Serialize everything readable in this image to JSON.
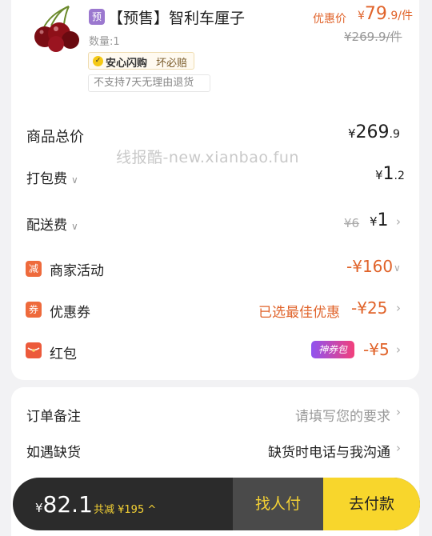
{
  "product": {
    "tag": "预",
    "title": "【预售】智利车厘子",
    "quantity": "数量:1",
    "price_label": "优惠价",
    "price_currency": "¥",
    "price_int": "79",
    "price_dec": ".9/件",
    "original_price": "¥269.9/件",
    "badge_check": "✓",
    "badge_assured": "安心闪购",
    "badge_broken": "坏必赔",
    "no_return": "不支持7天无理由退货"
  },
  "watermark": "线报酷-new.xianbao.fun",
  "summary": {
    "total": {
      "label": "商品总价",
      "currency": "¥",
      "int": "269",
      "dec": ".9"
    },
    "packing": {
      "label": "打包费",
      "currency": "¥",
      "int": "1",
      "dec": ".2"
    },
    "delivery": {
      "label": "配送费",
      "old": "¥6",
      "currency": "¥",
      "int": "1"
    },
    "merchant": {
      "icon": "减",
      "label": "商家活动",
      "value": "-¥160"
    },
    "coupon": {
      "icon": "券",
      "label": "优惠券",
      "note": "已选最佳优惠",
      "value": "-¥25"
    },
    "redpacket": {
      "label": "红包",
      "badge": "神券包",
      "value": "-¥5"
    }
  },
  "extra": {
    "remark": {
      "label": "订单备注",
      "value": "请填写您的要求"
    },
    "shortage": {
      "label": "如遇缺货",
      "value": "缺货时电话与我沟通"
    }
  },
  "bottom_bar": {
    "currency": "¥",
    "total": "82.1",
    "reduced": "共减 ¥195",
    "friend_pay": "找人付",
    "pay": "去付款"
  },
  "colors": {
    "accent": "#e0632a",
    "pay_button": "#f8d62c",
    "bar_bg": "#2b2b2b"
  }
}
